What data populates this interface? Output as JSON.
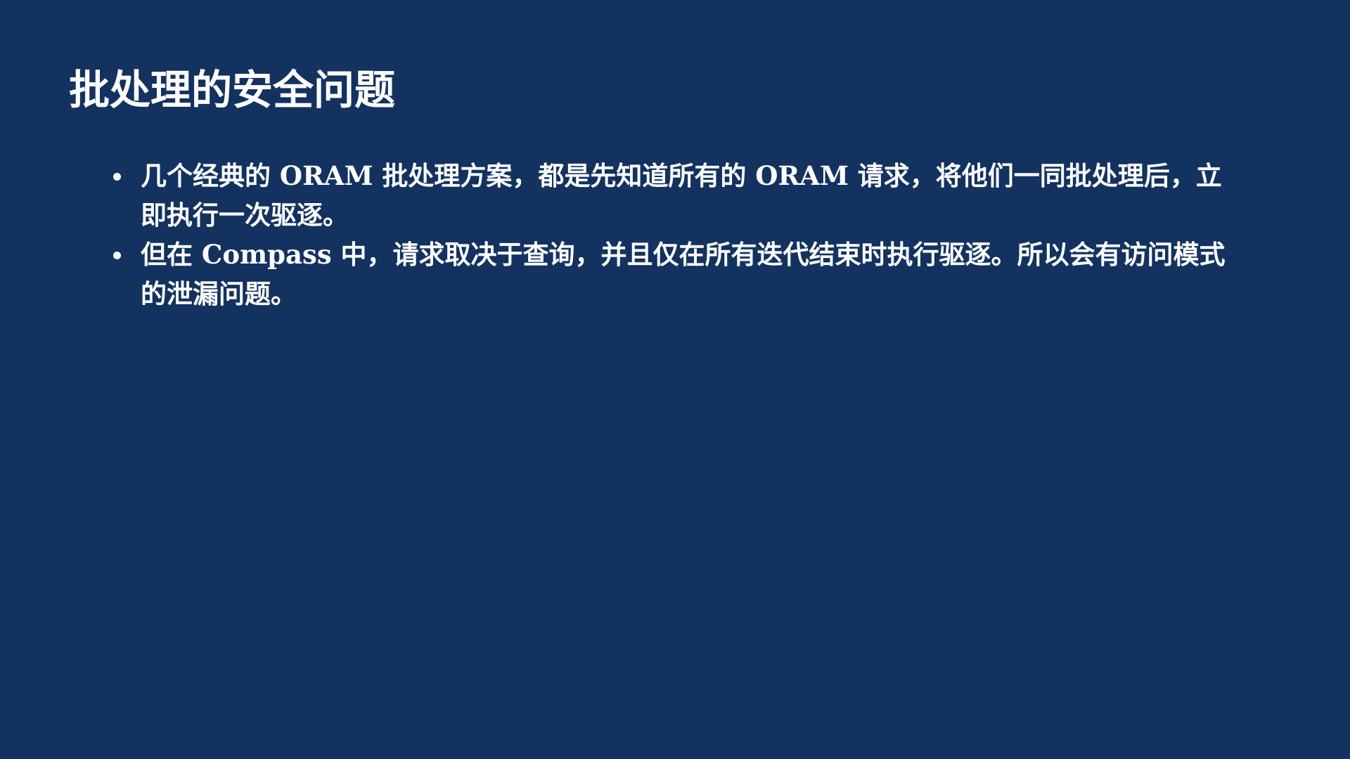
{
  "slide": {
    "title": "批处理的安全问题",
    "bullets": [
      {
        "text": "几个经典的 ORAM 批处理方案，都是先知道所有的 ORAM 请求，将他们一同批处理后，立即执行一次驱逐。"
      },
      {
        "text": "但在 Compass 中，请求取决于查询，并且仅在所有迭代结束时执行驱逐。所以会有访问模式的泄漏问题。"
      }
    ]
  },
  "colors": {
    "background": "#133260",
    "text": "#ffffff"
  }
}
